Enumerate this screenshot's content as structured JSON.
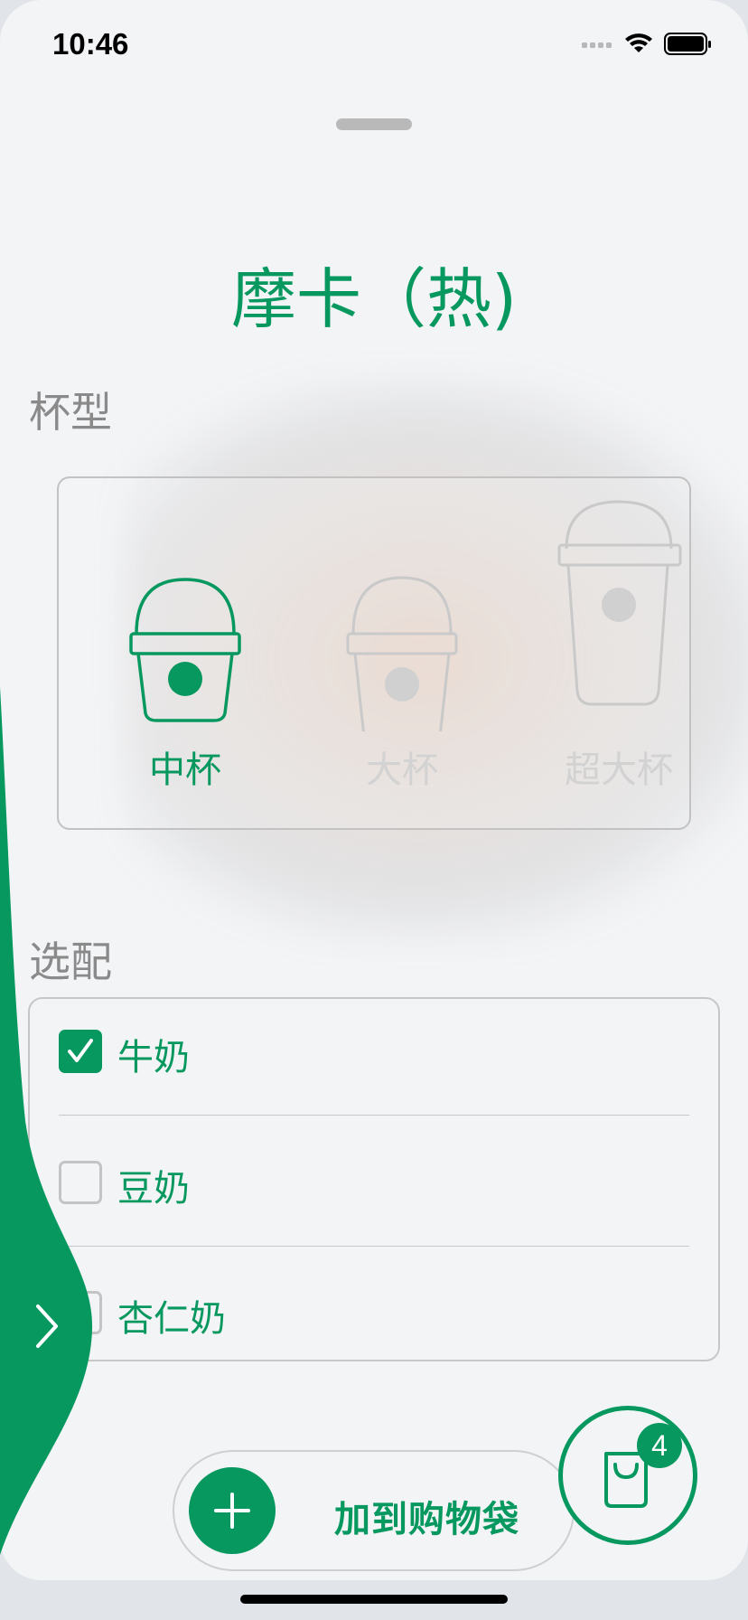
{
  "status_bar": {
    "time": "10:46"
  },
  "product": {
    "title": "摩卡（热)"
  },
  "cup_section": {
    "label": "杯型",
    "selected": "中杯",
    "options": [
      {
        "label": "中杯",
        "selected": true
      },
      {
        "label": "大杯",
        "selected": false
      },
      {
        "label": "超大杯",
        "selected": false
      }
    ]
  },
  "addons_section": {
    "label": "选配",
    "items": [
      {
        "label": "牛奶",
        "checked": true
      },
      {
        "label": "豆奶",
        "checked": false
      },
      {
        "label": "杏仁奶",
        "checked": false
      }
    ]
  },
  "actions": {
    "add_to_bag_label": "加到购物袋"
  },
  "cart": {
    "count": "4"
  },
  "colors": {
    "accent": "#06985f",
    "muted_text": "#8a8a8a",
    "disabled": "#c9c9c9",
    "background": "#f2f4f6"
  },
  "icons": [
    "signal-icon",
    "wifi-icon",
    "battery-icon",
    "cup-icon",
    "check-icon",
    "chevron-right-icon",
    "plus-icon",
    "shopping-bag-icon"
  ]
}
